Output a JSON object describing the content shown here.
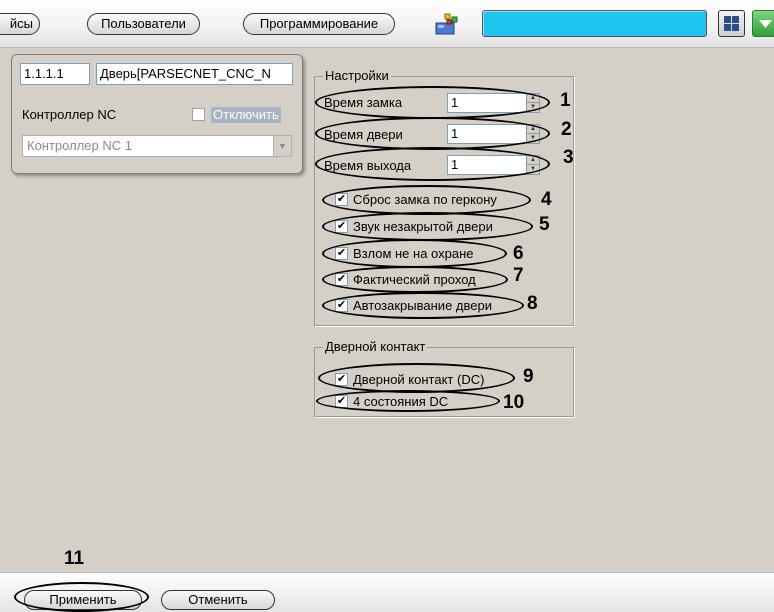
{
  "toolbar": {
    "tab_devices": "йсы",
    "tab_users": "Пользователи",
    "tab_programming": "Программирование",
    "accent_color": "#1ec4ee"
  },
  "left_panel": {
    "id_value": "1.1.1.1",
    "name_value": "Дверь[PARSECNET_CNC_N",
    "controller_label": "Контроллер NC",
    "disable_label": "Отключить",
    "disable_checked": false,
    "controller_select": "Контроллер NC 1"
  },
  "settings": {
    "title": "Настройки",
    "spins": [
      {
        "label": "Время замка",
        "value": "1",
        "number": "1"
      },
      {
        "label": "Время двери",
        "value": "1",
        "number": "2"
      },
      {
        "label": "Время выхода",
        "value": "1",
        "number": "3"
      }
    ],
    "checks": [
      {
        "label": "Сброс замка по геркону",
        "checked": true,
        "number": "4"
      },
      {
        "label": "Звук незакрытой двери",
        "checked": true,
        "number": "5"
      },
      {
        "label": "Взлом не на охране",
        "checked": true,
        "number": "6"
      },
      {
        "label": "Фактический проход",
        "checked": true,
        "number": "7"
      },
      {
        "label": "Автозакрывание двери",
        "checked": true,
        "number": "8"
      }
    ]
  },
  "door_contact": {
    "title": "Дверной контакт",
    "checks": [
      {
        "label": "Дверной контакт (DC)",
        "checked": true,
        "number": "9"
      },
      {
        "label": "4 состояния DC",
        "checked": true,
        "number": "10"
      }
    ]
  },
  "apply_number": "11",
  "bottom": {
    "apply_label": "Применить",
    "cancel_label": "Отменить"
  }
}
